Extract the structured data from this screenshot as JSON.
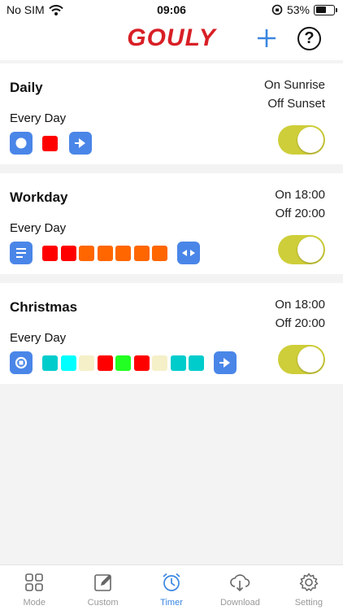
{
  "status_bar": {
    "carrier": "No SIM",
    "time": "09:06",
    "battery": "53%",
    "battery_level": 0.53
  },
  "header": {
    "logo": "GOULY",
    "add_icon": "plus-icon",
    "help_label": "?"
  },
  "timers": [
    {
      "name": "Daily",
      "repeat": "Every Day",
      "on": "On Sunrise",
      "off": "Off Sunset",
      "mode_icon": "circle-icon",
      "swatches": [
        "#ff0000"
      ],
      "action_icon": "play-arrow-icon",
      "enabled": true
    },
    {
      "name": "Workday",
      "repeat": "Every Day",
      "on": "On 18:00",
      "off": "Off 20:00",
      "mode_icon": "lines-icon",
      "swatches": [
        "#ff0000",
        "#ff0000",
        "#ff6600",
        "#ff6600",
        "#ff6600",
        "#ff6600",
        "#ff6600"
      ],
      "action_icon": "both-arrows-icon",
      "enabled": true
    },
    {
      "name": "Christmas",
      "repeat": "Every Day",
      "on": "On 18:00",
      "off": "Off 20:00",
      "mode_icon": "ring-square-icon",
      "swatches": [
        "#00cccc",
        "#00ffff",
        "#f5f0c8",
        "#ff0000",
        "#22ff22",
        "#ff0000",
        "#f5f0c8",
        "#00cccc",
        "#00cccc"
      ],
      "action_icon": "play-arrow-icon",
      "enabled": true
    }
  ],
  "tabs": [
    {
      "label": "Mode",
      "icon": "grid-icon",
      "active": false
    },
    {
      "label": "Custom",
      "icon": "edit-icon",
      "active": false
    },
    {
      "label": "Timer",
      "icon": "alarm-clock-icon",
      "active": true
    },
    {
      "label": "Download",
      "icon": "cloud-download-icon",
      "active": false
    },
    {
      "label": "Setting",
      "icon": "gear-icon",
      "active": false
    }
  ],
  "colors": {
    "accent": "#3a86e0",
    "button_blue": "#4a86e8",
    "toggle_on": "#cece3a",
    "logo_red": "#d81f26"
  }
}
